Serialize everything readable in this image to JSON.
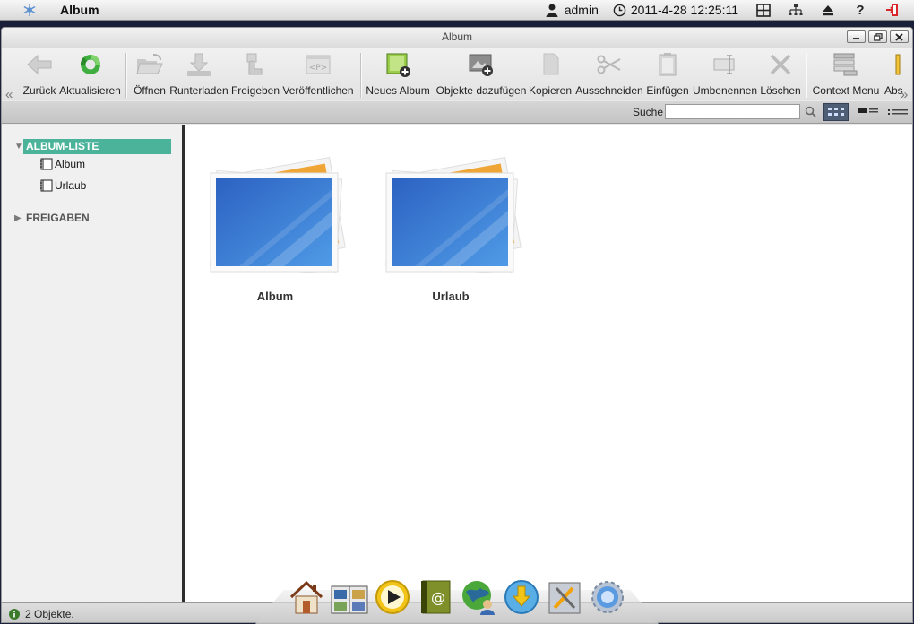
{
  "app": {
    "title": "Album",
    "window_title": "Album"
  },
  "sysbar": {
    "user": "admin",
    "datetime": "2011-4-28 12:25:11"
  },
  "toolbar": {
    "buttons": [
      {
        "label": "Zurück",
        "icon": "back-arrow-icon",
        "enabled": false
      },
      {
        "label": "Aktualisieren",
        "icon": "refresh-icon",
        "enabled": true
      },
      {
        "label": "Öffnen",
        "icon": "folder-open-icon",
        "enabled": false
      },
      {
        "label": "Runterladen",
        "icon": "download-icon",
        "enabled": false
      },
      {
        "label": "Freigeben",
        "icon": "share-icon",
        "enabled": false
      },
      {
        "label": "Veröffentlichen",
        "icon": "publish-icon",
        "enabled": false
      },
      {
        "label": "Neues Album",
        "icon": "new-album-icon",
        "enabled": true
      },
      {
        "label": "Objekte dazufügen",
        "icon": "add-objects-icon",
        "enabled": true
      },
      {
        "label": "Kopieren",
        "icon": "copy-icon",
        "enabled": false
      },
      {
        "label": "Ausschneiden",
        "icon": "scissors-icon",
        "enabled": false
      },
      {
        "label": "Einfügen",
        "icon": "paste-icon",
        "enabled": false
      },
      {
        "label": "Umbenennen",
        "icon": "rename-icon",
        "enabled": false
      },
      {
        "label": "Löschen",
        "icon": "delete-icon",
        "enabled": false
      },
      {
        "label": "Context Menu",
        "icon": "context-menu-icon",
        "enabled": true
      },
      {
        "label": "Abs",
        "icon": "info-icon",
        "enabled": true
      }
    ]
  },
  "search": {
    "label": "Suche",
    "value": "",
    "placeholder": ""
  },
  "sidebar": {
    "album_list_title": "ALBUM-LISTE",
    "albums": [
      "Album",
      "Urlaub"
    ],
    "shares_title": "FREIGABEN"
  },
  "content": {
    "albums": [
      {
        "name": "Album"
      },
      {
        "name": "Urlaub"
      }
    ]
  },
  "status": {
    "text": "2 Objekte."
  },
  "colors": {
    "selection": "#4cb39b",
    "thumb_blue": "#3a78d0",
    "splitter": "#2d2d2d"
  }
}
